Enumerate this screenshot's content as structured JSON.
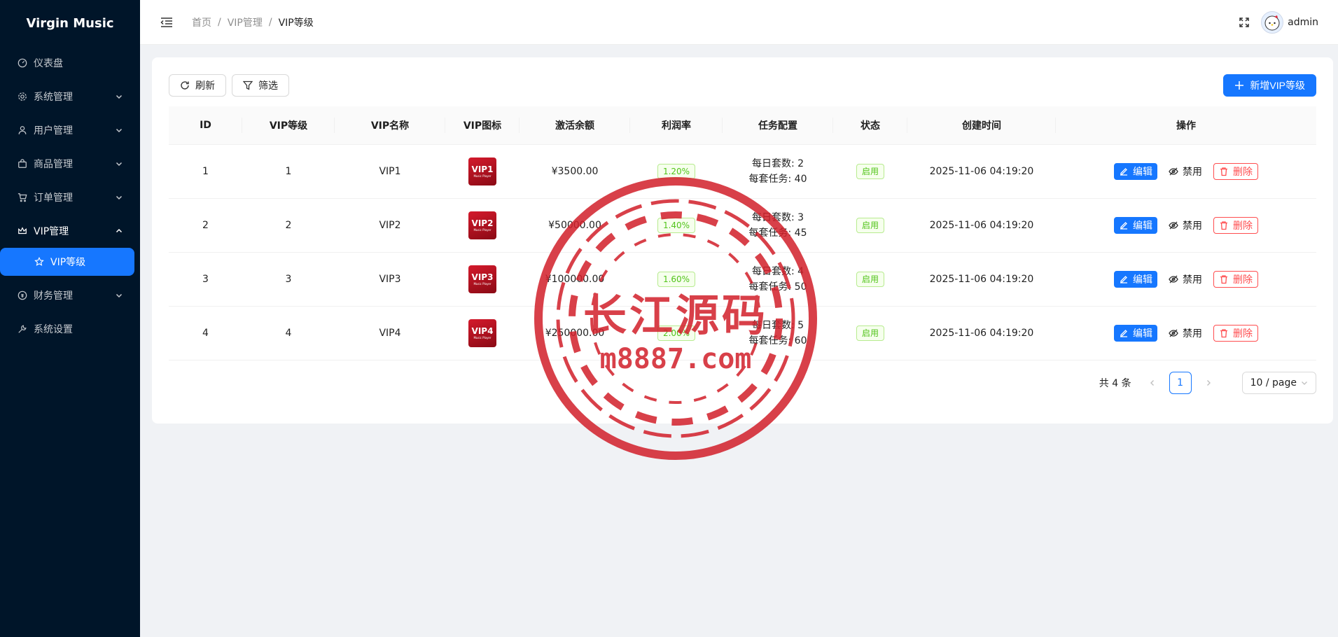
{
  "app": {
    "title": "Virgin Music"
  },
  "sidebar": {
    "items": [
      {
        "label": "仪表盘",
        "icon": "dashboard-icon"
      },
      {
        "label": "系统管理",
        "icon": "gear-icon"
      },
      {
        "label": "用户管理",
        "icon": "user-icon"
      },
      {
        "label": "商品管理",
        "icon": "shopping-bag-icon"
      },
      {
        "label": "订单管理",
        "icon": "cart-icon"
      },
      {
        "label": "VIP管理",
        "icon": "crown-icon"
      },
      {
        "label": "VIP等级",
        "icon": "star-icon"
      },
      {
        "label": "财务管理",
        "icon": "finance-icon"
      },
      {
        "label": "系统设置",
        "icon": "tool-icon"
      }
    ]
  },
  "header": {
    "breadcrumb": [
      "首页",
      "VIP管理",
      "VIP等级"
    ],
    "separator": "/",
    "username": "admin"
  },
  "toolbar": {
    "refresh": "刷新",
    "filter": "筛选",
    "add": "新增VIP等级"
  },
  "table": {
    "columns": [
      "ID",
      "VIP等级",
      "VIP名称",
      "VIP图标",
      "激活余额",
      "利润率",
      "任务配置",
      "状态",
      "创建时间",
      "操作"
    ],
    "rows": [
      {
        "id": "1",
        "level": "1",
        "name": "VIP1",
        "icon_text": "VIP1",
        "icon_sub": "Music Player",
        "balance": "¥3500.00",
        "rate": "1.20%",
        "daily": "每日套数: 2",
        "tasks": "每套任务: 40",
        "status": "启用",
        "created": "2025-11-06 04:19:20"
      },
      {
        "id": "2",
        "level": "2",
        "name": "VIP2",
        "icon_text": "VIP2",
        "icon_sub": "Music Player",
        "balance": "¥50000.00",
        "rate": "1.40%",
        "daily": "每日套数: 3",
        "tasks": "每套任务: 45",
        "status": "启用",
        "created": "2025-11-06 04:19:20"
      },
      {
        "id": "3",
        "level": "3",
        "name": "VIP3",
        "icon_text": "VIP3",
        "icon_sub": "Music Player",
        "balance": "¥100000.00",
        "rate": "1.60%",
        "daily": "每日套数: 4",
        "tasks": "每套任务: 50",
        "status": "启用",
        "created": "2025-11-06 04:19:20"
      },
      {
        "id": "4",
        "level": "4",
        "name": "VIP4",
        "icon_text": "VIP4",
        "icon_sub": "Music Player",
        "balance": "¥250000.00",
        "rate": "2.00%",
        "daily": "每日套数: 5",
        "tasks": "每套任务: 60",
        "status": "启用",
        "created": "2025-11-06 04:19:20"
      }
    ],
    "actions": {
      "edit": "编辑",
      "disable": "禁用",
      "delete": "删除"
    }
  },
  "pagination": {
    "total": "共 4 条",
    "current": "1",
    "size": "10 / page"
  },
  "watermark": {
    "cn": "长江源码",
    "url": "m8887.com"
  },
  "colors": {
    "sidebar": "#001529",
    "primary": "#1677ff",
    "danger": "#ff4d4f",
    "success": "#52c41a",
    "watermark": "#d21f2a"
  }
}
